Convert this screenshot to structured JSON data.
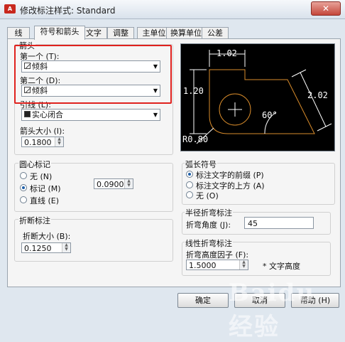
{
  "window": {
    "title": "修改标注样式: Standard",
    "icon_name": "autocad-app-icon",
    "close_label": "✕"
  },
  "tabs": [
    {
      "label": "线",
      "active": false
    },
    {
      "label": "符号和箭头",
      "active": true
    },
    {
      "label": "文字",
      "active": false
    },
    {
      "label": "调整",
      "active": false
    },
    {
      "label": "主单位",
      "active": false
    },
    {
      "label": "换算单位",
      "active": false
    },
    {
      "label": "公差",
      "active": false
    }
  ],
  "arrowheads": {
    "group_label": "箭头",
    "first_label": "第一个 (T):",
    "first_value": "倾斜",
    "second_label": "第二个 (D):",
    "second_value": "倾斜",
    "leader_label": "引线 (L):",
    "leader_value": "实心闭合",
    "size_label": "箭头大小 (I):",
    "size_value": "0.1800"
  },
  "center_marks": {
    "group_label": "圆心标记",
    "options": [
      "无 (N)",
      "标记 (M)",
      "直线 (E)"
    ],
    "selected": 1,
    "size_value": "0.0900"
  },
  "dim_break": {
    "group_label": "折断标注",
    "size_label": "折断大小 (B):",
    "size_value": "0.1250"
  },
  "arc_length_symbol": {
    "group_label": "弧长符号",
    "options": [
      "标注文字的前缀 (P)",
      "标注文字的上方 (A)",
      "无 (O)"
    ],
    "selected": 0
  },
  "radius_jog": {
    "group_label": "半径折弯标注",
    "angle_label": "折弯角度 (J):",
    "angle_value": "45"
  },
  "linear_jog": {
    "group_label": "线性折弯标注",
    "factor_label": "折弯高度因子 (F):",
    "factor_value": "1.5000",
    "suffix": "* 文字高度"
  },
  "preview": {
    "dim_top": "1.02",
    "dim_left": "1.20",
    "dim_right": "2.02",
    "dim_angle": "60°",
    "dim_radius": "R0.80",
    "colors": {
      "background": "#000000",
      "geometry": "#d98c2b",
      "dimensions": "#ffffff"
    }
  },
  "buttons": {
    "ok": "确定",
    "cancel": "取消",
    "help": "帮助 (H)"
  },
  "watermark": "Baidu 经验",
  "highlight_color": "#e0221e"
}
